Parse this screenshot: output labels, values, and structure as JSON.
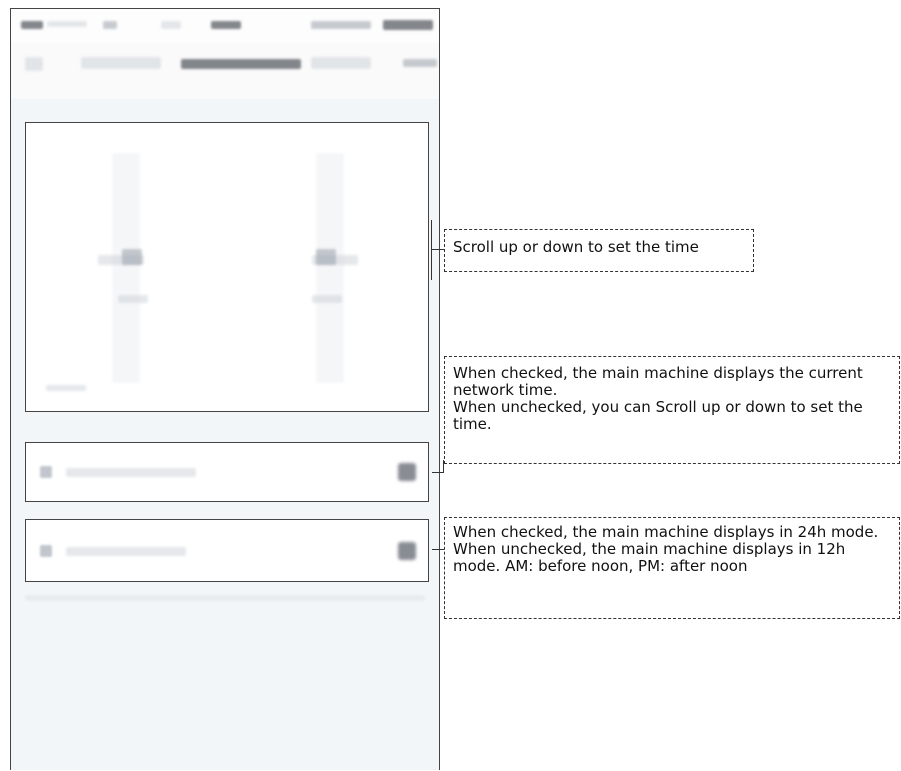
{
  "annotations": {
    "time_picker": "Scroll up or down to set the time",
    "network_time": {
      "line1": "When checked, the main machine displays the current network time.",
      "line2": "When unchecked, you can Scroll up or down to set the time."
    },
    "hour_mode": {
      "line1": "When checked, the main machine displays in 24h mode.",
      "line2": "When unchecked, the main machine displays in 12h mode. AM: before noon, PM: after noon"
    }
  },
  "colors": {
    "border": "#444444",
    "screen_bg": "#f3f6f9",
    "card_bg": "#ffffff"
  }
}
